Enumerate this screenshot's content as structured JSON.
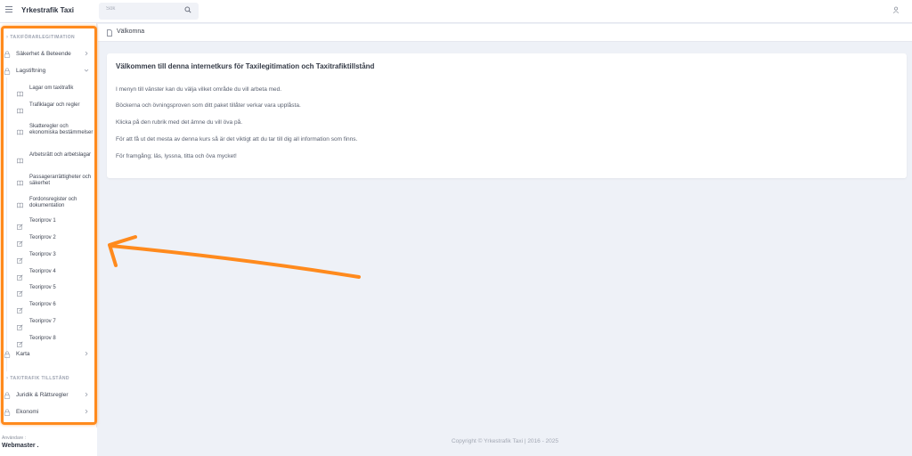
{
  "app": {
    "title": "Yrkestrafik Taxi"
  },
  "search": {
    "placeholder": "Sök"
  },
  "sidebar": {
    "sections": [
      {
        "label": "TAXIFÖRARLEGITIMATION"
      },
      {
        "label": "TAXITRAFIK TILLSTÅND"
      }
    ],
    "items": {
      "sakerhet": "Säkerhet & Beteende",
      "lagstiftning": "Lagstiftning",
      "karta": "Karta",
      "juridik": "Juridik & Rättsregler",
      "ekonomi": "Ekonomi"
    },
    "subitems": [
      {
        "label": "Lagar om taxitrafik",
        "icon": "book-icon"
      },
      {
        "label": "Trafiklagar och regler",
        "icon": "book-icon"
      },
      {
        "label": "Skatteregler och ekonomiska bestämmelser",
        "icon": "book-icon"
      },
      {
        "label": "Arbetsrätt och arbetslagar",
        "icon": "book-icon"
      },
      {
        "label": "Passagerarrättigheter och säkerhet",
        "icon": "book-icon"
      },
      {
        "label": "Fordonsregister och dokumentation",
        "icon": "book-icon"
      },
      {
        "label": "Teoriprov 1",
        "icon": "edit-icon"
      },
      {
        "label": "Teoriprov 2",
        "icon": "edit-icon"
      },
      {
        "label": "Teoriprov 3",
        "icon": "edit-icon"
      },
      {
        "label": "Teoriprov 4",
        "icon": "edit-icon"
      },
      {
        "label": "Teoriprov 5",
        "icon": "edit-icon"
      },
      {
        "label": "Teoriprov 6",
        "icon": "edit-icon"
      },
      {
        "label": "Teoriprov 7",
        "icon": "edit-icon"
      },
      {
        "label": "Teoriprov 8",
        "icon": "edit-icon"
      }
    ],
    "user_caption": "Användare :",
    "user_name": "Webmaster ."
  },
  "breadcrumb": {
    "label": "Välkomna"
  },
  "main": {
    "title": "Välkommen till denna internetkurs för Taxilegitimation och Taxitrafiktillstånd",
    "paragraphs": [
      "I menyn till vänster kan du välja vilket område du vill arbeta med.",
      "Böckerna och övningsproven som ditt paket tillåter verkar vara upplåsta.",
      "Klicka på den rubrik med det ämne du vill öva på.",
      "För att få ut det mesta av denna kurs så är det viktigt att du tar till dig all information som finns.",
      "För framgång; läs, lyssna, titta och öva mycket!"
    ]
  },
  "footer": {
    "text": "Copyright © Yrkestrafik Taxi | 2016 - 2025"
  },
  "colors": {
    "accent_annotation": "#ff8a1d",
    "background": "#eef1f7"
  }
}
